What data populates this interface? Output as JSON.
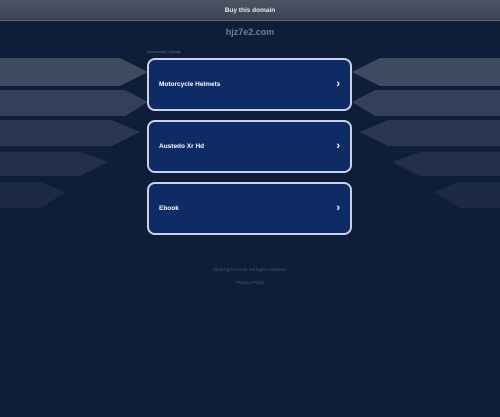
{
  "banner": {
    "label": "Buy this domain"
  },
  "site": {
    "domain": "hjz7e2.com"
  },
  "sponsored_label": "Sponsored Listings",
  "links": [
    {
      "label": "Motorcycle Helmets"
    },
    {
      "label": "Austedo Xr Hd"
    },
    {
      "label": "Ebook"
    }
  ],
  "footer": {
    "copyright": "2025 hjz7e2.com. All rights reserved.",
    "privacy": "Privacy Policy"
  },
  "icons": {
    "chevron": "›",
    "chevron_icon_name": "chevron-right-icon"
  },
  "colors": {
    "background": "#0e1d3a",
    "card_fill": "#0f2b65",
    "card_border": "#c9d3e3",
    "banner": "#444d5c"
  }
}
